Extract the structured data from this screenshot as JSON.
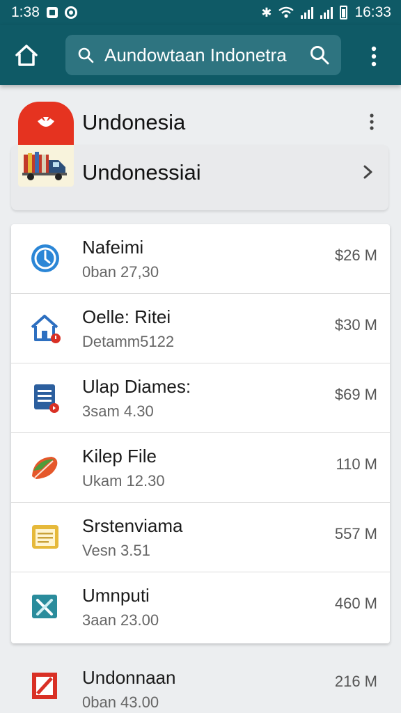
{
  "status_bar": {
    "time_left": "1:38",
    "time_right": "16:33",
    "bluetooth_icon": "bluetooth-icon",
    "wifi_icon": "wifi-icon"
  },
  "toolbar": {
    "home_icon": "home-icon",
    "search_value": "Aundowtaan Indonetra",
    "search_icon": "search-icon",
    "overflow_icon": "more-vert-icon"
  },
  "header": {
    "title": "Undonesia",
    "subtitle_row": "Undonessiai",
    "logo_icon": "app-logo",
    "sub_icon": "truck-icon"
  },
  "list": {
    "items": [
      {
        "title": "Nafeimi",
        "subtitle": "0ban 27,30",
        "size": "$26 M",
        "icon": "clock-icon",
        "color": "#2b86d6"
      },
      {
        "title": "Oelle: Ritei",
        "subtitle": "Detamm5122",
        "size": "$30 M",
        "icon": "house-icon",
        "color": "#2d6fc0"
      },
      {
        "title": "Ulap Diames:",
        "subtitle": "3sam 4.30",
        "size": "$69 M",
        "icon": "document-icon",
        "color": "#2c5f9e"
      },
      {
        "title": "Kilep File",
        "subtitle": "Ukam 12.30",
        "size": "110 M",
        "icon": "leaf-icon",
        "color": "#e5572a"
      },
      {
        "title": "Srstenviama",
        "subtitle": "Vesn 3.51",
        "size": "557 M",
        "icon": "notepad-icon",
        "color": "#e6b93a"
      },
      {
        "title": "Umnputi",
        "subtitle": "3aan 23.00",
        "size": "460 M",
        "icon": "tools-icon",
        "color": "#2a8c9c"
      }
    ],
    "bottom_item": {
      "title": "Undonnaan",
      "subtitle": "0ban 43.00",
      "size": "216 M",
      "icon": "pdf-icon",
      "color": "#d93025"
    }
  }
}
